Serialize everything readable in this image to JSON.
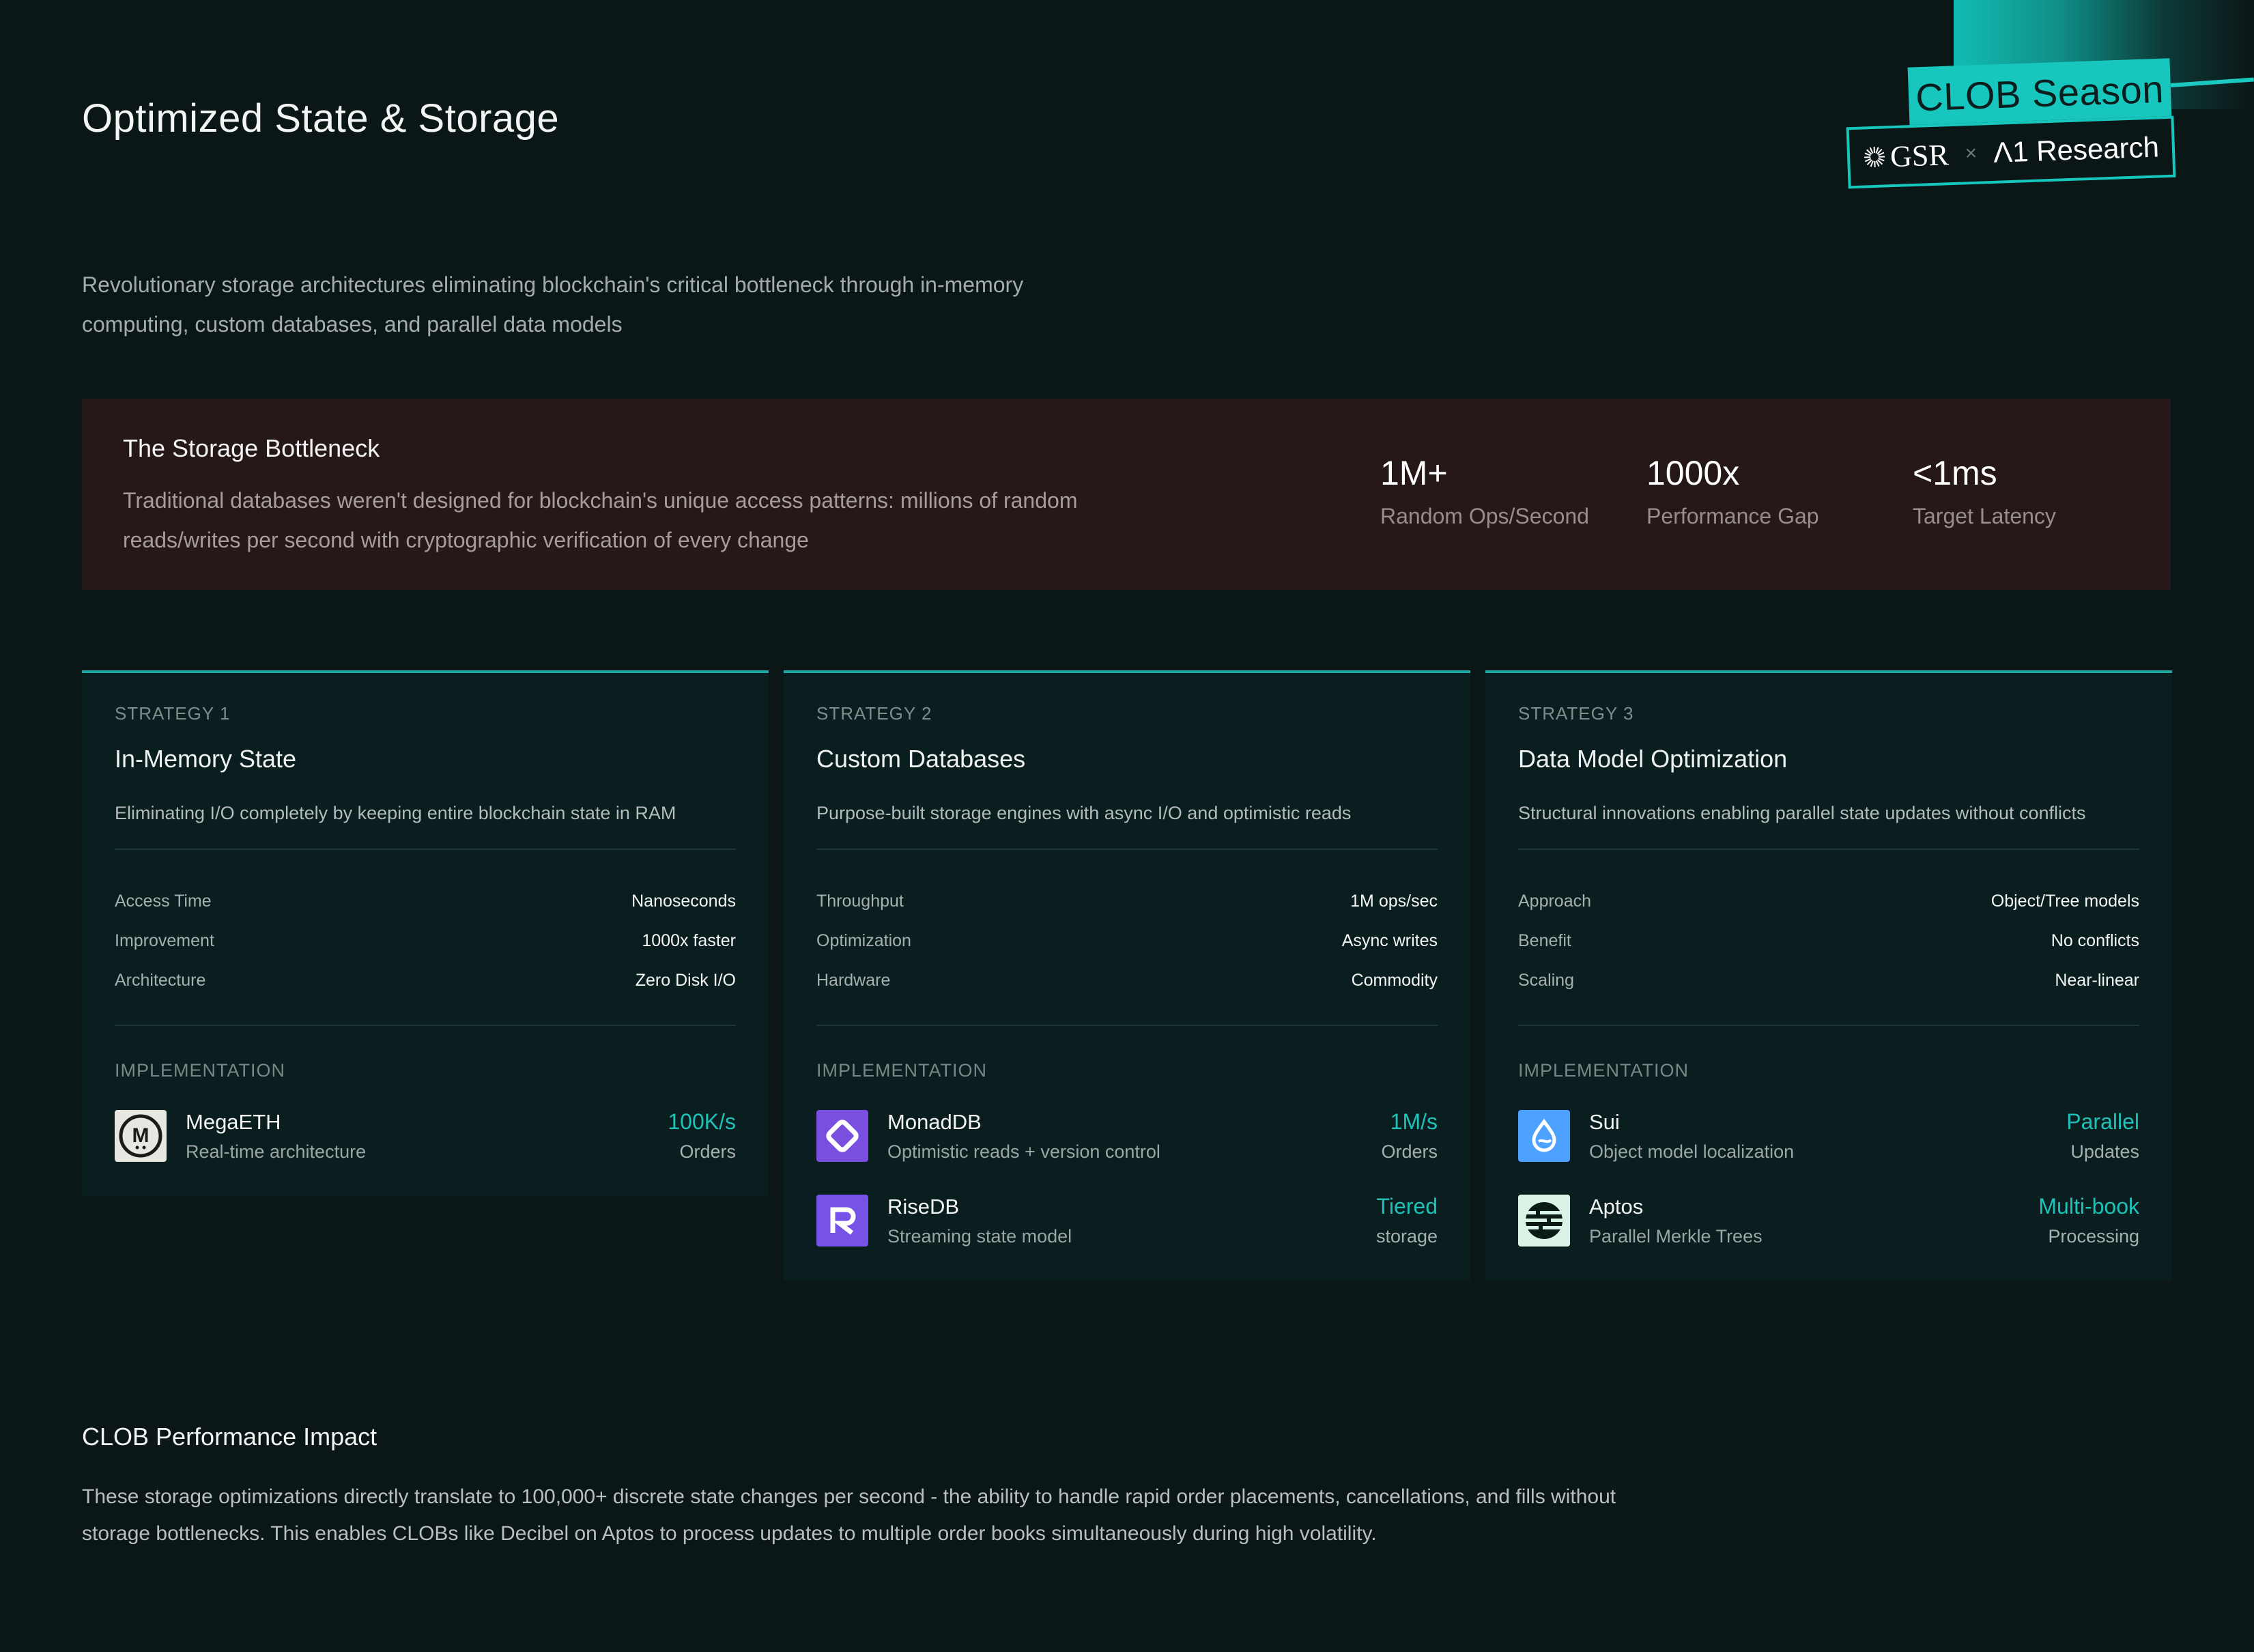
{
  "page": {
    "title": "Optimized State & Storage",
    "subtitle": "Revolutionary storage architectures eliminating blockchain's critical bottleneck through in-memory computing, custom databases, and parallel data models"
  },
  "badge": {
    "season": "CLOB Season",
    "partner1": "GSR",
    "separator": "×",
    "partner2": "Λ1 Research",
    "accent": "#17c7bd"
  },
  "bottleneck": {
    "title": "The Storage Bottleneck",
    "description": "Traditional databases weren't designed for blockchain's unique access patterns: millions of random reads/writes per second with cryptographic verification of every change",
    "stats": [
      {
        "value": "1M+",
        "label": "Random Ops/Second"
      },
      {
        "value": "1000x",
        "label": "Performance Gap"
      },
      {
        "value": "<1ms",
        "label": "Target Latency"
      }
    ]
  },
  "strategies": [
    {
      "kicker": "STRATEGY 1",
      "title": "In-Memory State",
      "description": "Eliminating I/O completely by keeping entire blockchain state in RAM",
      "specs": [
        {
          "key": "Access Time",
          "value": "Nanoseconds"
        },
        {
          "key": "Improvement",
          "value": "1000x faster"
        },
        {
          "key": "Architecture",
          "value": "Zero Disk I/O"
        }
      ],
      "impl_heading": "IMPLEMENTATION",
      "implementations": [
        {
          "name": "MegaETH",
          "sub": "Real-time architecture",
          "metric": "100K/s",
          "metric_label": "Orders",
          "icon": "megaeth-logo-icon"
        }
      ]
    },
    {
      "kicker": "STRATEGY 2",
      "title": "Custom Databases",
      "description": "Purpose-built storage engines with async I/O and optimistic reads",
      "specs": [
        {
          "key": "Throughput",
          "value": "1M ops/sec"
        },
        {
          "key": "Optimization",
          "value": "Async writes"
        },
        {
          "key": "Hardware",
          "value": "Commodity"
        }
      ],
      "impl_heading": "IMPLEMENTATION",
      "implementations": [
        {
          "name": "MonadDB",
          "sub": "Optimistic reads + version control",
          "metric": "1M/s",
          "metric_label": "Orders",
          "icon": "monad-logo-icon"
        },
        {
          "name": "RiseDB",
          "sub": "Streaming state model",
          "metric": "Tiered",
          "metric_label": "storage",
          "icon": "rise-logo-icon"
        }
      ]
    },
    {
      "kicker": "STRATEGY 3",
      "title": "Data Model Optimization",
      "description": "Structural innovations enabling parallel state updates without conflicts",
      "specs": [
        {
          "key": "Approach",
          "value": "Object/Tree models"
        },
        {
          "key": "Benefit",
          "value": "No conflicts"
        },
        {
          "key": "Scaling",
          "value": "Near-linear"
        }
      ],
      "impl_heading": "IMPLEMENTATION",
      "implementations": [
        {
          "name": "Sui",
          "sub": "Object model localization",
          "metric": "Parallel",
          "metric_label": "Updates",
          "icon": "sui-logo-icon"
        },
        {
          "name": "Aptos",
          "sub": "Parallel Merkle Trees",
          "metric": "Multi-book",
          "metric_label": "Processing",
          "icon": "aptos-logo-icon"
        }
      ]
    }
  ],
  "impact": {
    "title": "CLOB Performance Impact",
    "text": "These storage optimizations directly translate to 100,000+ discrete state changes per second - the ability to handle rapid order placements, cancellations, and fills without storage bottlenecks. This enables CLOBs like Decibel on Aptos to process updates to multiple order books simultaneously during high volatility."
  }
}
